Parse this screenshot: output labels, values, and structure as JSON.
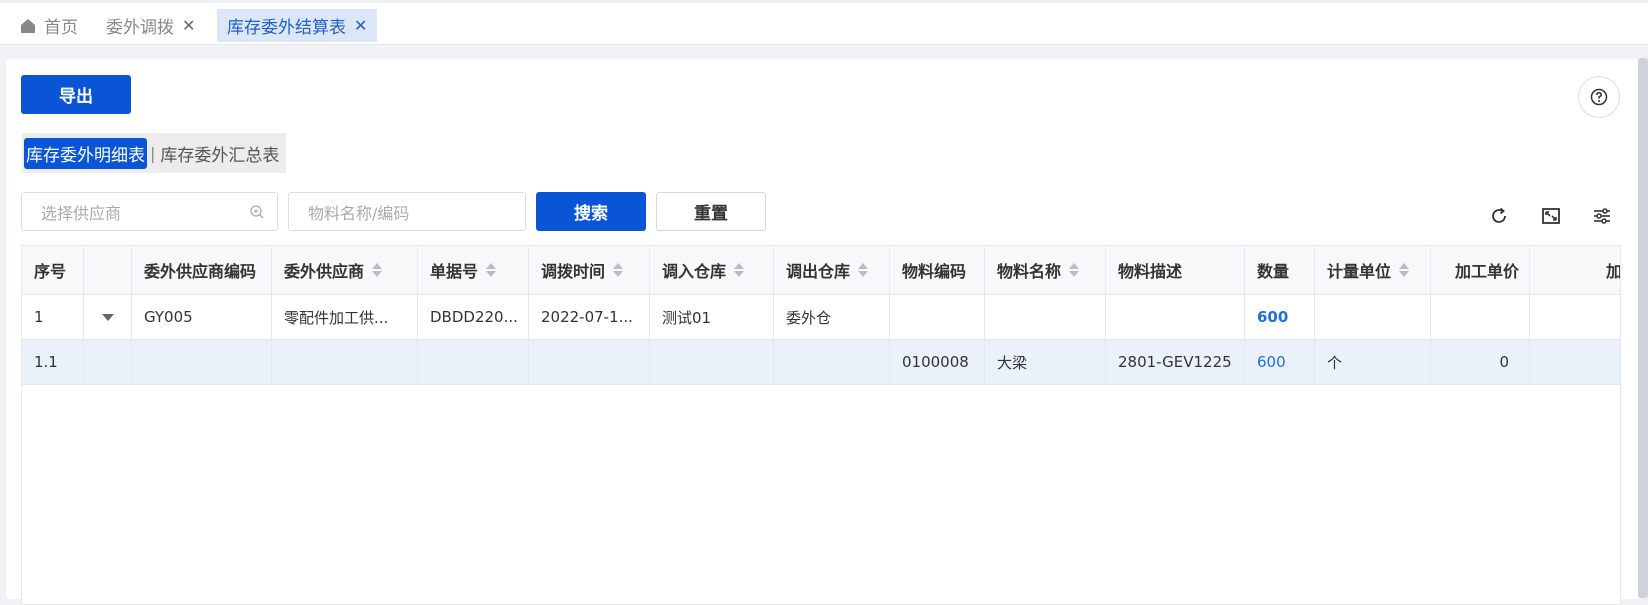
{
  "tabs": [
    {
      "label": "首页"
    },
    {
      "label": "委外调拨"
    },
    {
      "label": "库存委外结算表"
    }
  ],
  "toolbar": {
    "export_label": "导出"
  },
  "subtabs": [
    {
      "label": "库存委外明细表"
    },
    {
      "label": "库存委外汇总表"
    }
  ],
  "filters": {
    "supplier_placeholder": "选择供应商",
    "material_placeholder": "物料名称/编码",
    "search_label": "搜索",
    "reset_label": "重置"
  },
  "table": {
    "columns": [
      "序号",
      "",
      "委外供应商编码",
      "委外供应商",
      "单据号",
      "调拨时间",
      "调入仓库",
      "调出仓库",
      "物料编码",
      "物料名称",
      "物料描述",
      "数量",
      "计量单位",
      "加工单价",
      "加"
    ],
    "rows": [
      {
        "seq": "1",
        "supplier_code": "GY005",
        "supplier": "零配件加工供...",
        "doc_no": "DBDD220...",
        "time": "2022-07-1...",
        "in_wh": "测试01",
        "out_wh": "委外仓",
        "mat_code": "",
        "mat_name": "",
        "mat_desc": "",
        "qty": "600",
        "unit": "",
        "price": ""
      },
      {
        "seq": "1.1",
        "supplier_code": "",
        "supplier": "",
        "doc_no": "",
        "time": "",
        "in_wh": "",
        "out_wh": "",
        "mat_code": "0100008",
        "mat_name": "大梁",
        "mat_desc": "2801-GEV1225",
        "qty": "600",
        "unit": "个",
        "price": "0"
      }
    ]
  },
  "icons": [
    "home-icon",
    "close-icon",
    "help-icon",
    "search-icon",
    "refresh-icon",
    "fullscreen-icon",
    "column-settings-icon",
    "expand-caret-icon"
  ],
  "colors": {
    "primary": "#0a55d6",
    "link": "#1f6fd8",
    "active_tab_bg": "#dbe6f7",
    "selected_row_bg": "#eaf1fb"
  }
}
